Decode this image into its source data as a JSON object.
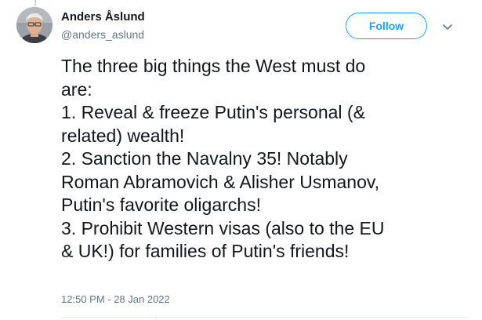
{
  "author": {
    "name": "Anders Åslund",
    "handle": "@anders_aslund",
    "avatar_icon": "avatar-photo"
  },
  "actions": {
    "follow_label": "Follow",
    "more_icon": "chevron-down-icon"
  },
  "tweet": {
    "lines": [
      "The three big things the West must do",
      "are:",
      "1. Reveal & freeze Putin's personal (&",
      "related) wealth!",
      "2. Sanction the Navalny 35! Notably",
      "Roman Abramovich & Alisher Usmanov,",
      "Putin's favorite oligarchs!",
      "3. Prohibit Western visas (also to the EU",
      "& UK!) for families of Putin's friends!"
    ],
    "timestamp": "12:50 PM - 28 Jan 2022"
  },
  "colors": {
    "accent": "#1da1f2",
    "text": "#14171a",
    "secondary_text": "#657786",
    "divider": "#e6ecf0"
  }
}
